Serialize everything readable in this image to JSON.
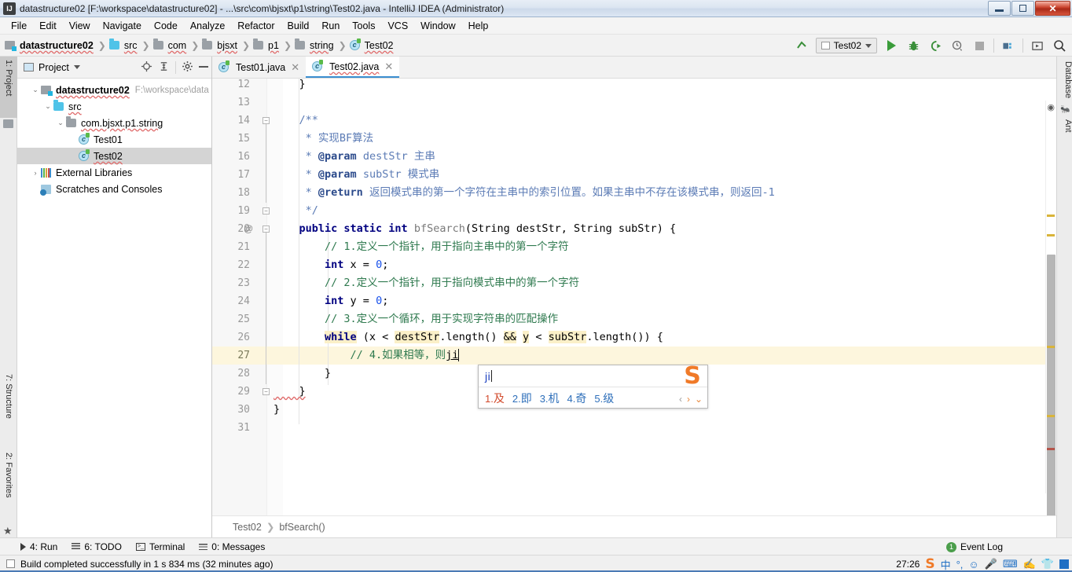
{
  "window": {
    "title": "datastructure02 [F:\\workspace\\datastructure02] - ...\\src\\com\\bjsxt\\p1\\string\\Test02.java - IntelliJ IDEA (Administrator)",
    "app_icon": "IJ",
    "controls": {
      "minimize": "minimize-icon",
      "restore": "restore-icon",
      "close": "✕"
    }
  },
  "menubar": {
    "items": [
      {
        "label": "File"
      },
      {
        "label": "Edit"
      },
      {
        "label": "View"
      },
      {
        "label": "Navigate"
      },
      {
        "label": "Code"
      },
      {
        "label": "Analyze"
      },
      {
        "label": "Refactor"
      },
      {
        "label": "Build"
      },
      {
        "label": "Run"
      },
      {
        "label": "Tools"
      },
      {
        "label": "VCS"
      },
      {
        "label": "Window"
      },
      {
        "label": "Help"
      }
    ]
  },
  "navbar": {
    "breadcrumbs": [
      {
        "label": "datastructure02",
        "icon": "module-icon"
      },
      {
        "label": "src",
        "icon": "source-folder-icon"
      },
      {
        "label": "com",
        "icon": "package-icon"
      },
      {
        "label": "bjsxt",
        "icon": "package-icon"
      },
      {
        "label": "p1",
        "icon": "package-icon"
      },
      {
        "label": "string",
        "icon": "package-icon"
      },
      {
        "label": "Test02",
        "icon": "class-icon"
      }
    ],
    "separator": "❯",
    "run_config": "Test02",
    "buttons": [
      "run-icon",
      "debug-icon",
      "run-coverage-icon",
      "profiler-icon",
      "stop-icon",
      "build-project-icon",
      "select-target-icon",
      "search-everywhere-icon"
    ]
  },
  "left_tool_strip": {
    "tabs": [
      {
        "label": "1: Project",
        "selected": true
      },
      {
        "label": "7: Structure",
        "selected": false
      },
      {
        "label": "2: Favorites",
        "selected": false
      }
    ]
  },
  "right_tool_strip": {
    "tabs": [
      {
        "label": "Database"
      },
      {
        "label": "Ant"
      }
    ]
  },
  "project_panel": {
    "title": "Project",
    "tools": [
      "locate-icon",
      "collapse-all-icon",
      "settings-gear-icon",
      "hide-icon"
    ],
    "tree": [
      {
        "label": "datastructure02",
        "path": "F:\\workspace\\data",
        "indent": 0,
        "arrow": "⌄",
        "icon": "module-icon",
        "bold": true,
        "selected": false
      },
      {
        "label": "src",
        "path": "",
        "indent": 1,
        "arrow": "⌄",
        "icon": "source-folder-icon",
        "bold": false,
        "selected": false
      },
      {
        "label": "com.bjsxt.p1.string",
        "path": "",
        "indent": 2,
        "arrow": "⌄",
        "icon": "package-icon",
        "bold": false,
        "selected": false
      },
      {
        "label": "Test01",
        "path": "",
        "indent": 3,
        "arrow": "",
        "icon": "class-icon",
        "bold": false,
        "selected": false
      },
      {
        "label": "Test02",
        "path": "",
        "indent": 3,
        "arrow": "",
        "icon": "class-icon",
        "bold": false,
        "selected": true
      },
      {
        "label": "External Libraries",
        "path": "",
        "indent": 0,
        "arrow": "›",
        "icon": "library-icon",
        "bold": false,
        "selected": false
      },
      {
        "label": "Scratches and Consoles",
        "path": "",
        "indent": 0,
        "arrow": "",
        "icon": "scratches-icon",
        "bold": false,
        "selected": false
      }
    ]
  },
  "editor": {
    "tabs": [
      {
        "label": "Test01.java",
        "active": false,
        "close": "✕"
      },
      {
        "label": "Test02.java",
        "active": true,
        "close": "✕"
      }
    ],
    "first_line_number": 12,
    "current_line": 27,
    "caret_position": "27:26",
    "lines": [
      {
        "n": 12,
        "text": "    }"
      },
      {
        "n": 13,
        "text": ""
      },
      {
        "n": 14,
        "text": "    /**"
      },
      {
        "n": 15,
        "text": "     * 实现BF算法"
      },
      {
        "n": 16,
        "text": "     * @param destStr 主串"
      },
      {
        "n": 17,
        "text": "     * @param subStr 模式串"
      },
      {
        "n": 18,
        "text": "     * @return 返回模式串的第一个字符在主串中的索引位置。如果主串中不存在该模式串，则返回-1"
      },
      {
        "n": 19,
        "text": "     */"
      },
      {
        "n": 20,
        "text": "    public static int bfSearch(String destStr, String subStr) {"
      },
      {
        "n": 21,
        "text": "        // 1.定义一个指针，用于指向主串中的第一个字符"
      },
      {
        "n": 22,
        "text": "        int x = 0;"
      },
      {
        "n": 23,
        "text": "        // 2.定义一个指针，用于指向模式串中的第一个字符"
      },
      {
        "n": 24,
        "text": "        int y = 0;"
      },
      {
        "n": 25,
        "text": "        // 3.定义一个循环，用于实现字符串的匹配操作"
      },
      {
        "n": 26,
        "text": "        while (x < destStr.length() && y < subStr.length()) {"
      },
      {
        "n": 27,
        "text": "            // 4.如果相等，则ji"
      },
      {
        "n": 28,
        "text": "        }"
      },
      {
        "n": 29,
        "text": "    }"
      },
      {
        "n": 30,
        "text": "}"
      },
      {
        "n": 31,
        "text": ""
      }
    ],
    "annotation_gutter": "@",
    "breadcrumb": [
      "Test02",
      "bfSearch()"
    ],
    "breadcrumb_separator": "❯"
  },
  "ime": {
    "typed": "ji",
    "candidates": [
      {
        "num": "1.",
        "word": "及"
      },
      {
        "num": "2.",
        "word": "即"
      },
      {
        "num": "3.",
        "word": "机"
      },
      {
        "num": "4.",
        "word": "奇"
      },
      {
        "num": "5.",
        "word": "级"
      }
    ],
    "prev": "‹",
    "next": "›",
    "expand": "⌄",
    "logo": "S"
  },
  "bottom_tabs": {
    "items": [
      {
        "label": "4: Run",
        "icon": "run-icon"
      },
      {
        "label": "6: TODO",
        "icon": "todo-icon"
      },
      {
        "label": "Terminal",
        "icon": "terminal-icon"
      },
      {
        "label": "0: Messages",
        "icon": "messages-icon"
      }
    ],
    "event_log": {
      "label": "Event Log",
      "count": "1"
    }
  },
  "statusbar": {
    "message": "Build completed successfully in 1 s 834 ms (32 minutes ago)",
    "caret": "27:26",
    "tray": [
      "sogou-logo-icon",
      "chinese-mode-icon",
      "punctuation-icon",
      "emoji-icon",
      "voice-input-icon",
      "soft-keyboard-icon",
      "handwriting-icon",
      "skin-icon",
      "toolbox-icon"
    ]
  },
  "colors": {
    "accent": "#3b8ed0",
    "keyword": "#000080",
    "comment": "#2f7a4f",
    "javadoc": "#5b7bb5",
    "number": "#1750eb",
    "current_line": "#fdf6dd",
    "selection_hl": "#fbf0c8",
    "error": "#c0392b",
    "warning": "#d4a017"
  }
}
